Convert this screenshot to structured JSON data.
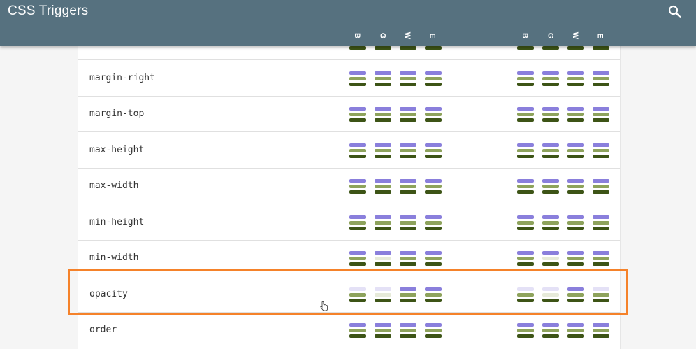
{
  "header": {
    "title": "CSS Triggers",
    "search_icon": "search-icon"
  },
  "columns": [
    "B",
    "G",
    "W",
    "E",
    "B",
    "G",
    "W",
    "E"
  ],
  "colors": {
    "header_bg": "#56717f",
    "layout": "#8a7fdc",
    "layout_off": "#e4e1f6",
    "paint": "#8ea35c",
    "paint_off": "#e6ead9",
    "composite": "#3d5416",
    "highlight": "#f5822a"
  },
  "rows": [
    {
      "name": "",
      "triggers": [
        [
          1,
          1,
          1
        ],
        [
          1,
          1,
          1
        ],
        [
          1,
          1,
          1
        ],
        [
          1,
          1,
          1
        ],
        [
          1,
          1,
          1
        ],
        [
          1,
          1,
          1
        ],
        [
          1,
          1,
          1
        ],
        [
          1,
          1,
          1
        ]
      ]
    },
    {
      "name": "margin-right",
      "triggers": [
        [
          1,
          1,
          1
        ],
        [
          1,
          1,
          1
        ],
        [
          1,
          1,
          1
        ],
        [
          1,
          1,
          1
        ],
        [
          1,
          1,
          1
        ],
        [
          1,
          1,
          1
        ],
        [
          1,
          1,
          1
        ],
        [
          1,
          1,
          1
        ]
      ]
    },
    {
      "name": "margin-top",
      "triggers": [
        [
          1,
          1,
          1
        ],
        [
          1,
          1,
          1
        ],
        [
          1,
          1,
          1
        ],
        [
          1,
          1,
          1
        ],
        [
          1,
          1,
          1
        ],
        [
          1,
          1,
          1
        ],
        [
          1,
          1,
          1
        ],
        [
          1,
          1,
          1
        ]
      ]
    },
    {
      "name": "max-height",
      "triggers": [
        [
          1,
          1,
          1
        ],
        [
          1,
          1,
          1
        ],
        [
          1,
          1,
          1
        ],
        [
          1,
          1,
          1
        ],
        [
          1,
          1,
          1
        ],
        [
          1,
          1,
          1
        ],
        [
          1,
          1,
          1
        ],
        [
          1,
          1,
          1
        ]
      ]
    },
    {
      "name": "max-width",
      "triggers": [
        [
          1,
          1,
          1
        ],
        [
          1,
          1,
          1
        ],
        [
          1,
          1,
          1
        ],
        [
          1,
          1,
          1
        ],
        [
          1,
          1,
          1
        ],
        [
          1,
          1,
          1
        ],
        [
          1,
          1,
          1
        ],
        [
          1,
          1,
          1
        ]
      ]
    },
    {
      "name": "min-height",
      "triggers": [
        [
          1,
          1,
          1
        ],
        [
          1,
          1,
          1
        ],
        [
          1,
          1,
          1
        ],
        [
          1,
          1,
          1
        ],
        [
          1,
          1,
          1
        ],
        [
          1,
          1,
          1
        ],
        [
          1,
          1,
          1
        ],
        [
          1,
          1,
          1
        ]
      ]
    },
    {
      "name": "min-width",
      "triggers": [
        [
          1,
          1,
          1
        ],
        [
          1,
          0,
          1
        ],
        [
          1,
          1,
          1
        ],
        [
          1,
          1,
          1
        ],
        [
          1,
          1,
          1
        ],
        [
          1,
          0,
          1
        ],
        [
          1,
          1,
          1
        ],
        [
          1,
          1,
          1
        ]
      ]
    },
    {
      "name": "opacity",
      "triggers": [
        [
          0,
          1,
          1
        ],
        [
          0,
          0,
          1
        ],
        [
          1,
          1,
          1
        ],
        [
          1,
          1,
          1
        ],
        [
          0,
          1,
          1
        ],
        [
          0,
          0,
          1
        ],
        [
          1,
          1,
          1
        ],
        [
          0,
          1,
          1
        ]
      ]
    },
    {
      "name": "order",
      "triggers": [
        [
          1,
          1,
          1
        ],
        [
          1,
          1,
          1
        ],
        [
          1,
          1,
          1
        ],
        [
          1,
          1,
          1
        ],
        [
          1,
          1,
          1
        ],
        [
          1,
          1,
          1
        ],
        [
          1,
          1,
          1
        ],
        [
          1,
          1,
          1
        ]
      ]
    }
  ]
}
